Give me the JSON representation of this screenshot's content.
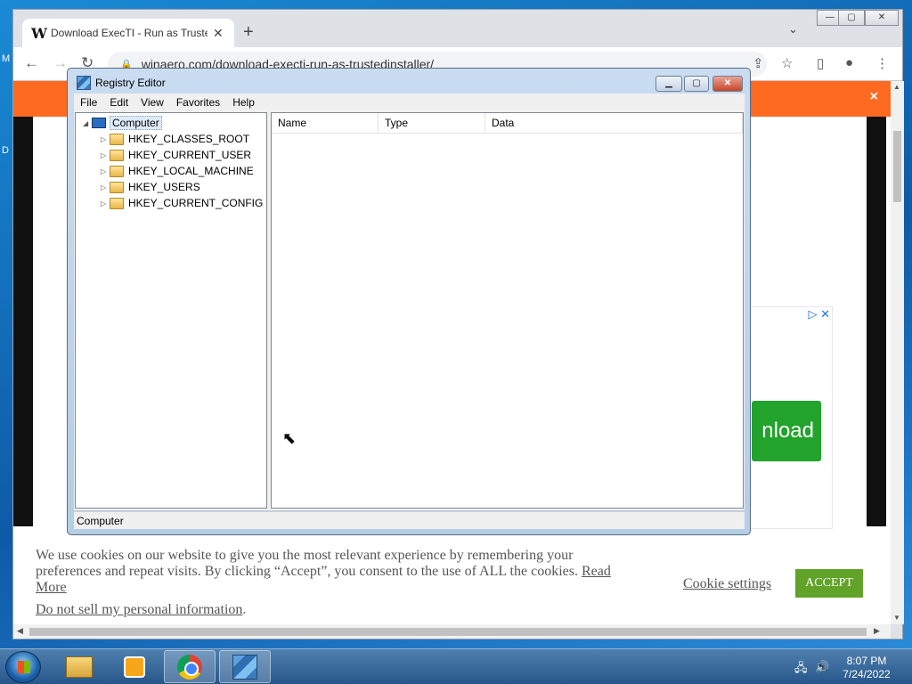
{
  "desktop": {
    "left_edge_label_1": "M",
    "left_edge_label_2": "D"
  },
  "browser": {
    "tab": {
      "favicon": "W",
      "title": "Download ExecTI - Run as TrustedInstaller",
      "close_icon": "close-icon"
    },
    "new_tab_icon": "+",
    "url": "winaero.com/download-execti-run-as-trustedinstaller/",
    "window_controls": {
      "minimize": "—",
      "maximize": "▢",
      "close": "✕"
    }
  },
  "page": {
    "banner_close": "×",
    "ad": {
      "download_button": "nload",
      "ad_icons": "▷ ✕"
    },
    "cookie": {
      "text": "We use cookies on our website to give you the most relevant experience by remembering your preferences and repeat visits. By clicking “Accept”, you consent to the use of ALL the cookies.",
      "read_more": "Read More",
      "do_not_sell": "Do not sell my personal information",
      "do_not_sell_suffix": ".",
      "settings": "Cookie settings",
      "accept": "ACCEPT"
    }
  },
  "regedit": {
    "title": "Registry Editor",
    "controls": {
      "minimize": "▁",
      "maximize": "▢",
      "close": "✕"
    },
    "menu": [
      "File",
      "Edit",
      "View",
      "Favorites",
      "Help"
    ],
    "tree": {
      "root": "Computer",
      "children": [
        "HKEY_CLASSES_ROOT",
        "HKEY_CURRENT_USER",
        "HKEY_LOCAL_MACHINE",
        "HKEY_USERS",
        "HKEY_CURRENT_CONFIG"
      ]
    },
    "columns": [
      "Name",
      "Type",
      "Data"
    ],
    "status": "Computer"
  },
  "taskbar": {
    "clock_time": "8:07 PM",
    "clock_date": "7/24/2022",
    "items": [
      "explorer",
      "media-player",
      "chrome",
      "registry-editor"
    ]
  }
}
